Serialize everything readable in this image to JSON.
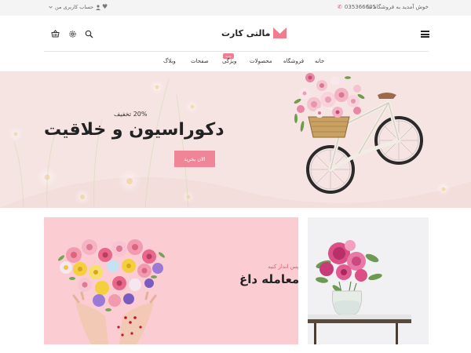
{
  "topbar": {
    "welcome": "خوش آمدید به فروشگاه ما",
    "phone": "035366605",
    "account": "حساب کاربری من",
    "phone_icon": "phone-icon",
    "user_icon": "user-icon",
    "heart_icon": "heart-icon"
  },
  "header": {
    "logo_text": "مالتی کارت",
    "logo_color": "#f07c8e",
    "icons": [
      "basket-icon",
      "gear-icon",
      "search-icon",
      "menu-icon"
    ]
  },
  "nav": {
    "items": [
      "خانه",
      "فروشگاه",
      "محصولات",
      "ویژگی",
      "صفحات",
      "وبلاگ"
    ],
    "badge": "جدید"
  },
  "hero": {
    "kicker": "20% تخفیف",
    "title": "دکوراسیون و خلاقیت",
    "cta": "الان بخرید",
    "accent": "#ef8596",
    "background": "#f6e4e3"
  },
  "banners": [
    {
      "kicker": "30% پس انداز کنید",
      "title": "معامله داغ",
      "background": "#fcccd3"
    },
    {
      "background": "#f1f1f3"
    }
  ]
}
